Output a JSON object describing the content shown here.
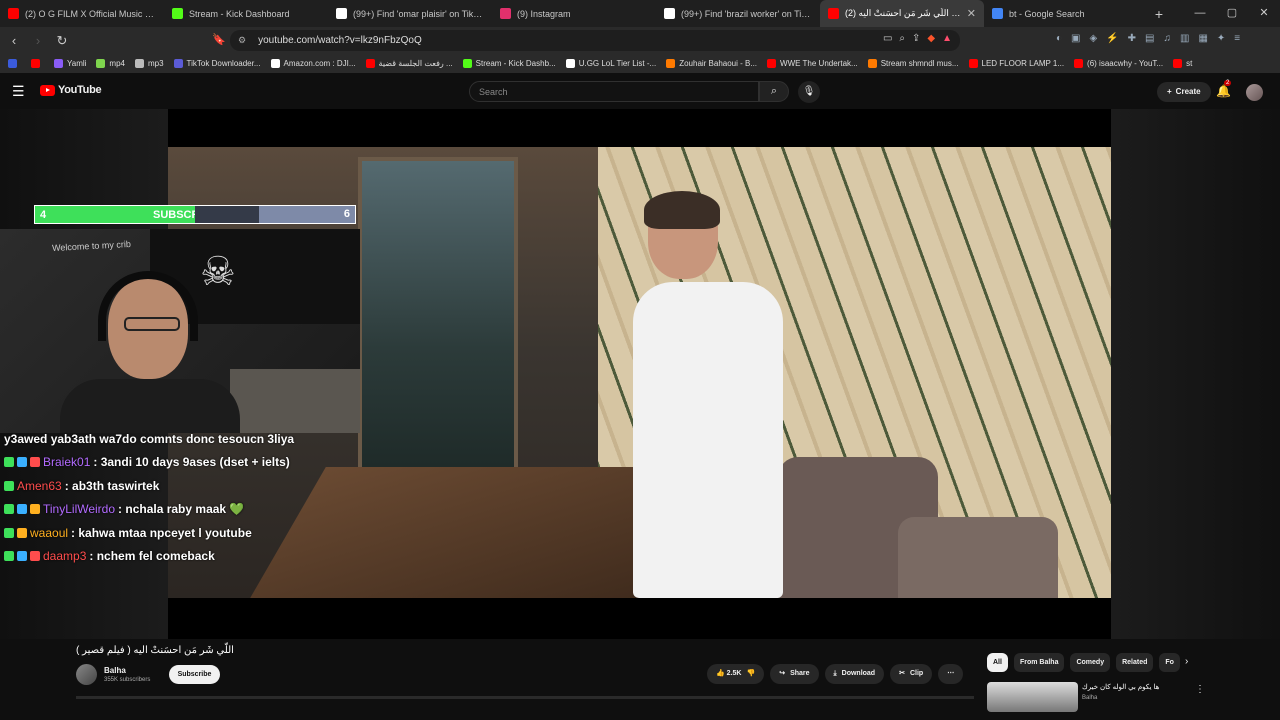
{
  "tabs": [
    {
      "title": "(2) O G FILM X Official Music Vidéo",
      "color": "#ff0000",
      "active": false
    },
    {
      "title": "Stream - Kick Dashboard",
      "color": "#53fc18",
      "active": false
    },
    {
      "title": "(99+) Find 'omar plaisir' on TikTok | T",
      "color": "#ffffff",
      "active": false
    },
    {
      "title": "(9) Instagram",
      "color": "#e1306c",
      "active": false
    },
    {
      "title": "(99+) Find 'brazil worker' on TikTok |",
      "color": "#ffffff",
      "active": false
    },
    {
      "title": "(2) اللّي شَر مَن احسَنتْ اليه ( ...",
      "color": "#ff0000",
      "active": true
    },
    {
      "title": "bt - Google Search",
      "color": "#4285f4",
      "active": false
    }
  ],
  "new_tab": "+",
  "url": "youtube.com/watch?v=lkz9nFbzQoQ",
  "bookmarks": [
    {
      "label": "",
      "color": "#3b5bdb"
    },
    {
      "label": "",
      "color": "#ff0000"
    },
    {
      "label": "Yamli",
      "color": "#8a5cf6"
    },
    {
      "label": "mp4",
      "color": "#7fd54e"
    },
    {
      "label": "mp3",
      "color": "#bbbbbb"
    },
    {
      "label": "TikTok Downloader...",
      "color": "#5b5bd6"
    },
    {
      "label": "Amazon.com : DJI...",
      "color": "#ffffff"
    },
    {
      "label": "رفعت الجلسة قضية ...",
      "color": "#ff0000"
    },
    {
      "label": "Stream - Kick Dashb...",
      "color": "#53fc18"
    },
    {
      "label": "U.GG LoL Tier List -...",
      "color": "#ffffff"
    },
    {
      "label": "Zouhair Bahaoui - B...",
      "color": "#ff7a00"
    },
    {
      "label": "WWE The Undertak...",
      "color": "#ff0000"
    },
    {
      "label": "Stream shmndl mus...",
      "color": "#ff7a00"
    },
    {
      "label": "LED FLOOR LAMP 1...",
      "color": "#ff0000"
    },
    {
      "label": "(6) isaacwhy - YouT...",
      "color": "#ff0000"
    },
    {
      "label": "st",
      "color": "#ff0000"
    }
  ],
  "youtube": {
    "logo": "YouTube",
    "search_placeholder": "Search",
    "create_label": "Create",
    "notif_count": "2"
  },
  "overlay": {
    "sub_current": "4",
    "sub_label": "SUBSCRIBERS",
    "sub_goal": "6",
    "sub_progress": 0.6667,
    "webcam_note": "Welcome to my crib"
  },
  "chat": [
    {
      "user": "",
      "user_color": "#ffffff",
      "msg": "y3awed yab3ath wa7do comnts donc tesoucn 3liya",
      "badges": []
    },
    {
      "user": "Braiek01",
      "user_color": "#b26bff",
      "msg": ": 3andi 10 days 9ases (dset + ielts)",
      "badges": [
        "#3ee05a",
        "#3ab0ff",
        "#ff4d4d"
      ]
    },
    {
      "user": "Amen63",
      "user_color": "#ff4d4d",
      "msg": ": ab3th taswirtek",
      "badges": [
        "#3ee05a"
      ]
    },
    {
      "user": "TinyLilWeirdo",
      "user_color": "#b26bff",
      "msg": ": nchala raby maak 💚",
      "badges": [
        "#3ee05a",
        "#3ab0ff",
        "#ffb020"
      ]
    },
    {
      "user": "waaoul",
      "user_color": "#ffb020",
      "msg": ": kahwa mtaa npceyet l youtube",
      "badges": [
        "#3ee05a",
        "#ffb020"
      ]
    },
    {
      "user": "daamp3",
      "user_color": "#ff4d4d",
      "msg": ": nchem fel comeback",
      "badges": [
        "#3ee05a",
        "#3ab0ff",
        "#ff4d4d"
      ]
    }
  ],
  "video": {
    "title": "اللّي شَر مَن احسَنتْ اليه ( فيلم قصير )",
    "channel": "Balha",
    "subscribers": "355K subscribers",
    "subscribe_label": "Subscribe",
    "likes": "2.5K",
    "share_label": "Share",
    "download_label": "Download",
    "clip_label": "Clip"
  },
  "chips": [
    "All",
    "From Balha",
    "Comedy",
    "Related",
    "Fo"
  ],
  "recommended": {
    "title": "ها يكوم بي الوله كان خيرك",
    "channel": "Balha"
  }
}
